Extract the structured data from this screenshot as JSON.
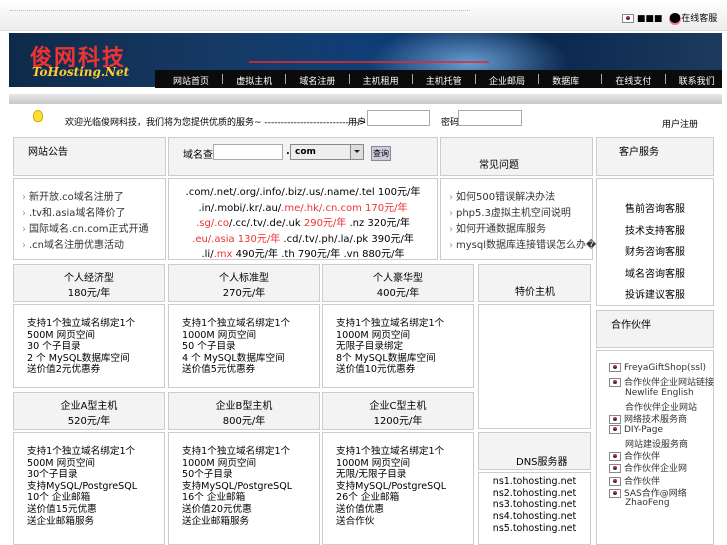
{
  "top": {
    "lang_glyph": "■■■",
    "qq_label": "在线客服"
  },
  "brand": {
    "name_cn": "俊网科技",
    "name_en": "ToHosting.Net"
  },
  "nav": [
    "网站首页",
    "虚拟主机",
    "域名注册",
    "主机租用",
    "主机托管",
    "企业邮局",
    "数据库",
    "在线支付",
    "联系我们"
  ],
  "notice": {
    "text": "欢迎光临俊网科技，我们将为您提供优质的服务~ ----------------------------->"
  },
  "login": {
    "user_label": "用户:",
    "pass_label": "密码:",
    "register": "用户注册"
  },
  "sections": {
    "news": "网站公告",
    "domain_query": "域名查询",
    "faq": "常见问题",
    "support": "客户服务",
    "special": "特价主机",
    "partners": "合作伙伴",
    "dns": "DNS服务器"
  },
  "domain_search": {
    "label": "域名查询",
    "dot": ".",
    "selected": "com",
    "button": "查询"
  },
  "news_items": [
    "新开放.co域名注册了",
    ".tv和.asia域名降价了",
    "国际域名.cn.com正式开通",
    ".cn域名注册优惠活动"
  ],
  "domain_prices": [
    [
      {
        "t": ".com/.net/.org/.info/.biz/.us/.name/.tel 100元/年"
      }
    ],
    [
      {
        "t": ".in/.mobi/.kr/.au/"
      },
      {
        "t": ".me/.hk/.cn.com 170元/年",
        "red": true
      }
    ],
    [
      {
        "t": ".sg/.co",
        "red": true
      },
      {
        "t": "/.cc/.tv/.de/.uk "
      },
      {
        "t": "290元/年",
        "red": true
      },
      {
        "t": " .nz 320元/年"
      }
    ],
    [
      {
        "t": ".eu/.asia 130元/年",
        "red": true
      },
      {
        "t": " .cd/.tv/.ph/.la/.pk 390元/年"
      }
    ],
    [
      {
        "t": ".li/"
      },
      {
        "t": ".mx",
        "red": true
      },
      {
        "t": " 490元/年 .th 790元/年 .vn 880元/年"
      }
    ]
  ],
  "faq_items": [
    "如何500错误解决办法",
    "php5.3虚拟主机空间说明",
    "如何开通数据库服务",
    "mysql数据库连接错误怎么办�..."
  ],
  "support_items": [
    "售前咨询客服",
    "技术支持客服",
    "财务咨询客服",
    "域名咨询客服",
    "投诉建议客服"
  ],
  "plans_row1": [
    {
      "name": "个人经济型",
      "price": "180元/年",
      "features": "支持1个独立域名绑定1个\n500M 网页空间\n30 个子目录\n2 个 MySQL数据库空间\n送价值2元优惠券"
    },
    {
      "name": "个人标准型",
      "price": "270元/年",
      "features": "支持1个独立域名绑定1个\n1000M 网页空间\n50 个子目录\n4 个 MySQL数据库空间\n送价值5元优惠券"
    },
    {
      "name": "个人豪华型",
      "price": "400元/年",
      "features": "支持1个独立域名绑定1个\n1000M 网页空间\n无限子目录绑定\n8个 MySQL数据库空间\n送价值10元优惠券"
    }
  ],
  "plans_row2": [
    {
      "name": "企业A型主机",
      "price": "520元/年",
      "features": "支持1个独立域名绑定1个\n500M 网页空间\n30个子目录\n支持MySQL/PostgreSQL\n10个 企业邮箱\n送价值15元优惠\n送企业邮箱服务"
    },
    {
      "name": "企业B型主机",
      "price": "800元/年",
      "features": "支持1个独立域名绑定1个\n1000M 网页空间\n50个子目录\n支持MySQL/PostgreSQL\n16个 企业邮箱\n送价值20元优惠\n送企业邮箱服务"
    },
    {
      "name": "企业C型主机",
      "price": "1200元/年",
      "features": "支持1个独立域名绑定1个\n1000M 网页空间\n无限/无限子目录\n支持MySQL/PostgreSQL\n26个 企业邮箱\n送价值优惠\n送合作伙"
    }
  ],
  "partners": [
    {
      "flag": true,
      "lines": [
        "FreyaGiftShop(ssl)"
      ]
    },
    {
      "flag": true,
      "lines": [
        "合作伙伴企业网站链接",
        "Newlife English"
      ]
    },
    {
      "flag": false,
      "lines": [
        "合作伙伴企业网站"
      ]
    },
    {
      "flag": true,
      "lines": [
        "网络技术服务商"
      ]
    },
    {
      "flag": true,
      "lines": [
        "DIY-Page"
      ]
    },
    {
      "flag": false,
      "lines": [
        "网站建设服务商"
      ]
    },
    {
      "flag": true,
      "lines": [
        "合作伙伴"
      ]
    },
    {
      "flag": true,
      "lines": [
        "合作伙伴企业网"
      ]
    },
    {
      "flag": true,
      "lines": [
        "合作伙伴"
      ]
    },
    {
      "flag": true,
      "lines": [
        "SAS合作@网络",
        "ZhaoFeng"
      ]
    }
  ],
  "dns": [
    "ns1.tohosting.net",
    "ns2.tohosting.net",
    "ns3.tohosting.net",
    "ns4.tohosting.net",
    "ns5.tohosting.net"
  ]
}
